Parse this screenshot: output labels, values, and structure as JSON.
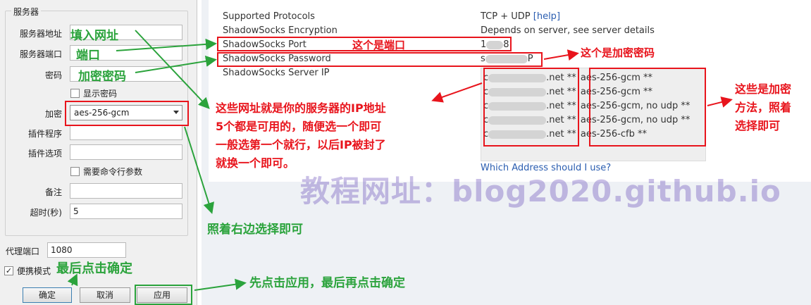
{
  "dialog": {
    "group_title": "服务器",
    "labels": {
      "address": "服务器地址",
      "port": "服务器端口",
      "password": "密码",
      "encryption": "加密",
      "plugin": "插件程序",
      "plugin_options": "插件选项",
      "remarks": "备注",
      "timeout": "超时(秒)",
      "proxy_port": "代理端口"
    },
    "show_password": "显示密码",
    "need_cmd_args": "需要命令行参数",
    "encryption_value": "aes-256-gcm",
    "timeout_value": "5",
    "proxy_port_value": "1080",
    "portable_mode": "便携模式",
    "portable_checked": "✓",
    "buttons": {
      "ok": "确定",
      "cancel": "取消",
      "apply": "应用"
    }
  },
  "server_details": {
    "rows": [
      {
        "label": "Supported Protocols",
        "value": "TCP + UDP",
        "link": "[help]"
      },
      {
        "label": "ShadowSocks Encryption",
        "value": "Depends on server, see server details"
      },
      {
        "label": "ShadowSocks Port",
        "value_start": "1",
        "value_end": "8"
      },
      {
        "label": "ShadowSocks Password",
        "value_start": "s",
        "value_end": "P"
      },
      {
        "label": "ShadowSocks Server IP"
      }
    ],
    "servers": [
      {
        "prefix": "c",
        "domain": ".net **",
        "method": "aes-256-gcm **"
      },
      {
        "prefix": "c",
        "domain": ".net **",
        "method": "aes-256-gcm **"
      },
      {
        "prefix": "c",
        "domain": ".net **",
        "method": "aes-256-gcm, no udp **"
      },
      {
        "prefix": "c",
        "domain": ".net **",
        "method": "aes-256-gcm, no udp **"
      },
      {
        "prefix": "c",
        "domain": ".net **",
        "method": "aes-256-cfb **"
      }
    ],
    "which_address": "Which Address should I use?"
  },
  "annotations": {
    "fill_url": "填入网址",
    "port": "端口",
    "encryption_password": "加密密码",
    "this_is_port": "这个是端口",
    "this_is_password": "这个是加密密码",
    "ip_explain": [
      "这些网址就是你的服务器的IP地址",
      "5个都是可用的，随便选一个即可",
      "一般选第一个就行，以后IP被封了",
      "就换一个即可。"
    ],
    "methods_explain": [
      "这些是加密",
      "方法，照着",
      "选择即可"
    ],
    "follow_right": "照着右边选择即可",
    "finally_ok": "最后点击确定",
    "apply_then_ok": "先点击应用，最后再点击确定",
    "watermark": "教程网址：blog2020.github.io"
  },
  "colors": {
    "green": "#2ba33c",
    "red": "#e8141c",
    "link": "#2a5db0"
  }
}
